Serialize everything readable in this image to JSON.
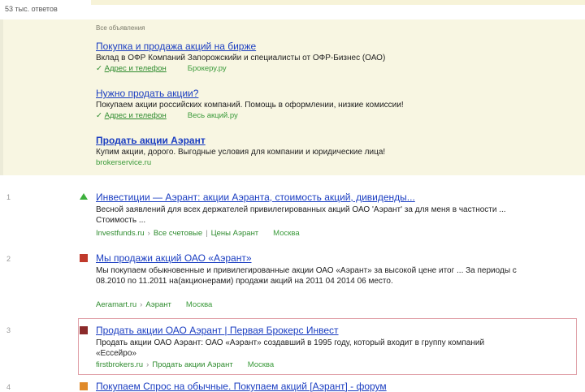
{
  "header": {
    "found_text": "53 тыс. ответов"
  },
  "ads": {
    "label": "Все объявления",
    "items": [
      {
        "title": "Покупка и продажа акций на бирже",
        "text": "Вклад в ОФР Компаний Запорожскийи и специалисты от ОФР-Бизнес (ОАО)",
        "links": [
          "Адрес и телефон",
          "Брокеру.ру"
        ]
      },
      {
        "title": "Нужно продать акции?",
        "text": "Покупаем акции российских компаний. Помощь в оформлении, низкие комиссии!",
        "links": [
          "Адрес и телефон",
          "Весь акций.ру"
        ]
      },
      {
        "title": "Продать акции Аэрант",
        "text": "Купим акции, дорого. Выгодные условия для компании и юридические лица!",
        "links": [
          "brokerservice.ru"
        ]
      }
    ]
  },
  "results": [
    {
      "num": "1",
      "icon": "green-triangle-icon",
      "title": "Инвестиции — Аэрант: акции Аэранта, стоимость акций, дивиденды...",
      "snippet": "Весной заявлений для всех держателей привилегированных акций ОАО 'Аэрант' за для меня в частности ... Стоимость ...",
      "meta": [
        "Investfunds.ru",
        "Все счетовые",
        "Цены Аэрант"
      ],
      "region": "Москва"
    },
    {
      "num": "2",
      "icon": "red-square-icon",
      "title": "Мы продажи акций ОАО «Аэрант»",
      "snippet": "Мы покупаем обыкновенные и привилегированные акции ОАО «Аэрант» за высокой цене итог ... За периоды с 08.2010 по 11.2011 на(акционерами) продажи акций на 2011 04 2014 06 место.",
      "meta": [
        "Aeramart.ru",
        "Аэрант"
      ],
      "region": "Москва"
    },
    {
      "num": "3",
      "icon": "dark-square-icon",
      "title": "Продать акции ОАО Аэрант | Первая Брокерс Инвест",
      "snippet": "Продать акции ОАО Аэрант: ОАО «Аэрант» создавший в 1995 году, который входит в группу компаний «Ессейро»",
      "meta": [
        "firstbrokers.ru",
        "Продать акции Аэрант"
      ],
      "region": "Москва"
    },
    {
      "num": "4",
      "icon": "orange-square-icon",
      "title": "Покупаем Спрос на обычные. Покупаем акций [Аэрант] - форум",
      "snippet": "",
      "meta": [],
      "region": ""
    }
  ]
}
